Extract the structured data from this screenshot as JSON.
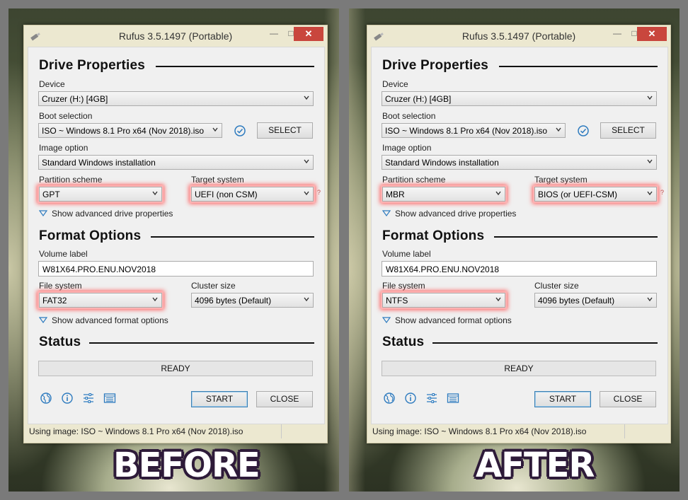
{
  "panels": [
    {
      "title": "Rufus 3.5.1497 (Portable)",
      "drive_properties_heading": "Drive Properties",
      "device_label": "Device",
      "device_value": "Cruzer (H:) [4GB]",
      "boot_selection_label": "Boot selection",
      "boot_selection_value": "ISO ~ Windows 8.1 Pro x64 (Nov 2018).iso",
      "select_button": "SELECT",
      "image_option_label": "Image option",
      "image_option_value": "Standard Windows installation",
      "partition_scheme_label": "Partition scheme",
      "partition_scheme_value": "GPT",
      "target_system_label": "Target system",
      "target_system_value": "UEFI (non CSM)",
      "help_mark": "?",
      "advanced_drive_toggle": "Show advanced drive properties",
      "format_options_heading": "Format Options",
      "volume_label_label": "Volume label",
      "volume_label_value": "W81X64.PRO.ENU.NOV2018",
      "file_system_label": "File system",
      "file_system_value": "FAT32",
      "cluster_size_label": "Cluster size",
      "cluster_size_value": "4096 bytes (Default)",
      "advanced_format_toggle": "Show advanced format options",
      "status_heading": "Status",
      "status_text": "READY",
      "start_button": "START",
      "close_button": "CLOSE",
      "statusbar_text": "Using image: ISO ~ Windows 8.1 Pro x64 (Nov 2018).iso",
      "caption": "BEFORE"
    },
    {
      "title": "Rufus 3.5.1497 (Portable)",
      "drive_properties_heading": "Drive Properties",
      "device_label": "Device",
      "device_value": "Cruzer (H:) [4GB]",
      "boot_selection_label": "Boot selection",
      "boot_selection_value": "ISO ~ Windows 8.1 Pro x64 (Nov 2018).iso",
      "select_button": "SELECT",
      "image_option_label": "Image option",
      "image_option_value": "Standard Windows installation",
      "partition_scheme_label": "Partition scheme",
      "partition_scheme_value": "MBR",
      "target_system_label": "Target system",
      "target_system_value": "BIOS (or UEFI-CSM)",
      "help_mark": "?",
      "advanced_drive_toggle": "Show advanced drive properties",
      "format_options_heading": "Format Options",
      "volume_label_label": "Volume label",
      "volume_label_value": "W81X64.PRO.ENU.NOV2018",
      "file_system_label": "File system",
      "file_system_value": "NTFS",
      "cluster_size_label": "Cluster size",
      "cluster_size_value": "4096 bytes (Default)",
      "advanced_format_toggle": "Show advanced format options",
      "status_heading": "Status",
      "status_text": "READY",
      "start_button": "START",
      "close_button": "CLOSE",
      "statusbar_text": "Using image: ISO ~ Windows 8.1 Pro x64 (Nov 2018).iso",
      "caption": "AFTER"
    }
  ],
  "icons": [
    "usb-drive-icon",
    "minimize-icon",
    "maximize-icon",
    "close-icon",
    "checkmark-circle-icon",
    "chevron-down-icon",
    "expand-triangle-icon",
    "globe-icon",
    "info-icon",
    "settings-sliders-icon",
    "log-icon"
  ],
  "colors": {
    "highlight_glow": "#ff5a5a",
    "close_button_red": "#c9463d",
    "caption_outline": "#2f1c3a",
    "accent_blue": "#2e7bbf"
  }
}
